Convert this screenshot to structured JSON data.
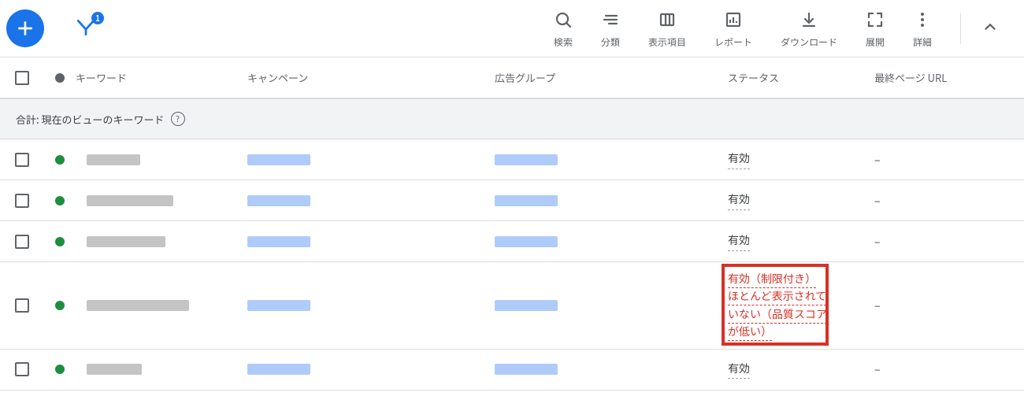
{
  "toolbar": {
    "filter_count": "1",
    "items": [
      {
        "label": "検索"
      },
      {
        "label": "分類"
      },
      {
        "label": "表示項目"
      },
      {
        "label": "レポート"
      },
      {
        "label": "ダウンロード"
      },
      {
        "label": "展開"
      },
      {
        "label": "詳細"
      }
    ]
  },
  "table": {
    "headers": {
      "keyword": "キーワード",
      "campaign": "キャンペーン",
      "adgroup": "広告グループ",
      "status": "ステータス",
      "url": "最終ページ URL"
    },
    "summary_label": "合計: 現在のビューのキーワード",
    "rows": [
      {
        "status": "有効",
        "url": "–",
        "highlight": false
      },
      {
        "status": "有効",
        "url": "–",
        "highlight": false
      },
      {
        "status": "有効",
        "url": "–",
        "highlight": false
      },
      {
        "status_line1": "有効（制限付き）",
        "status_line2": "ほとんど表示されて",
        "status_line3": "いない（品質スコア",
        "status_line4": "が低い）",
        "url": "–",
        "highlight": true
      },
      {
        "status": "有効",
        "url": "–",
        "highlight": false
      }
    ]
  }
}
